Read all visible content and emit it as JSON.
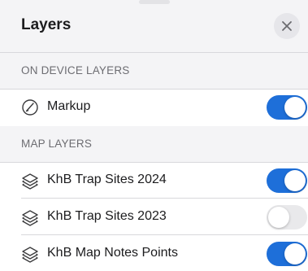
{
  "panel": {
    "title": "Layers"
  },
  "sections": {
    "on_device": {
      "label": "ON DEVICE LAYERS",
      "rows": [
        {
          "label": "Markup",
          "icon": "markup-icon",
          "enabled": true
        }
      ]
    },
    "map_layers": {
      "label": "MAP LAYERS",
      "rows": [
        {
          "label": "KhB Trap Sites 2024",
          "icon": "layers-stack-icon",
          "enabled": true
        },
        {
          "label": "KhB Trap Sites 2023",
          "icon": "layers-stack-icon",
          "enabled": false
        },
        {
          "label": "KhB Map Notes Points",
          "icon": "layers-stack-icon",
          "enabled": true
        }
      ]
    }
  },
  "colors": {
    "accent": "#1e6fd9",
    "toggle_off": "#e9e9eb",
    "header_bg": "#f4f4f6"
  }
}
